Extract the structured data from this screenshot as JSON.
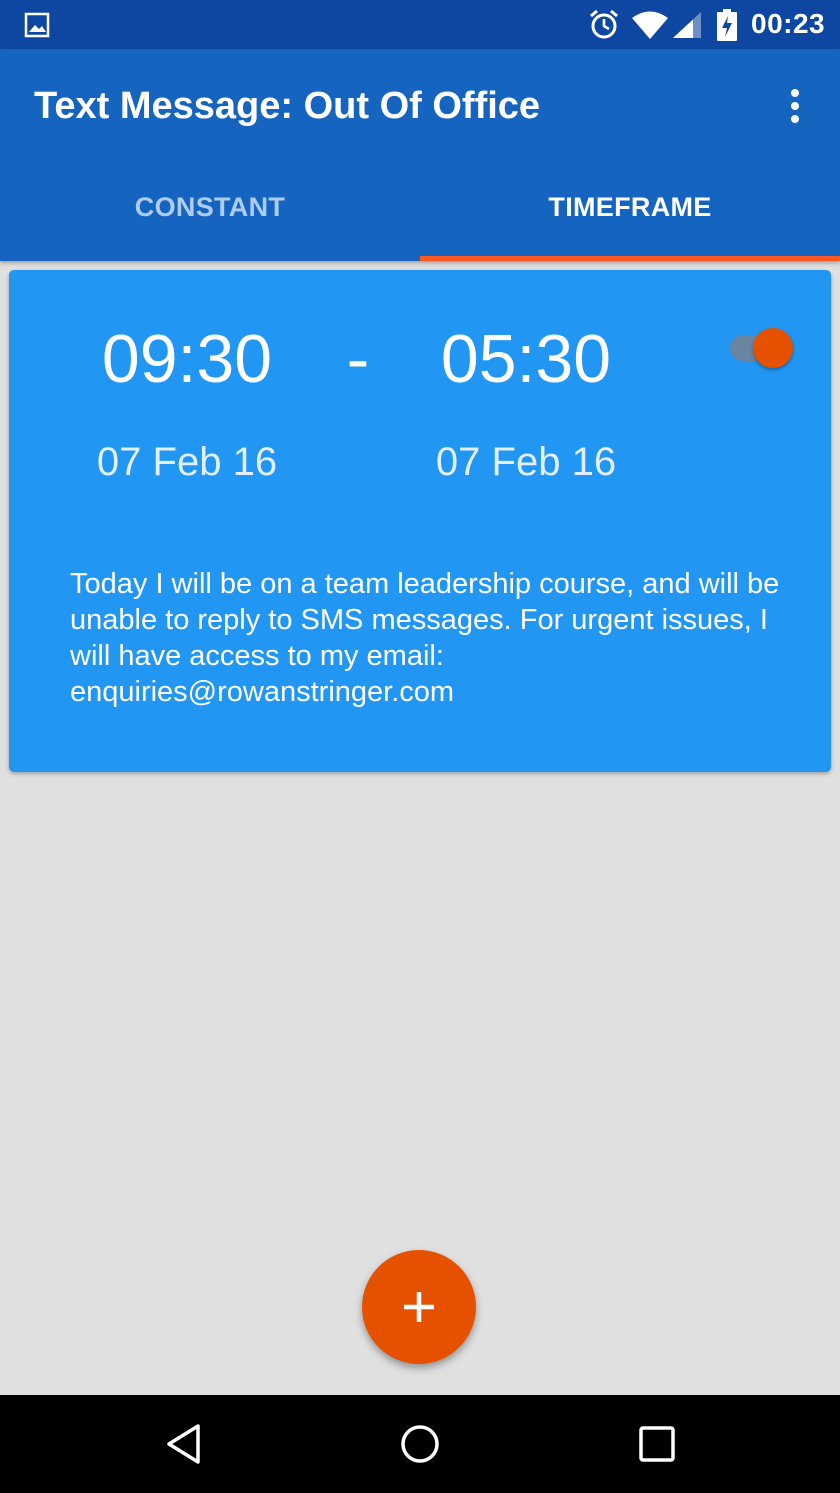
{
  "status_bar": {
    "time": "00:23",
    "icons": [
      "gallery-icon",
      "alarm-icon",
      "wifi-icon",
      "signal-icon",
      "battery-charging-icon"
    ]
  },
  "app_bar": {
    "title": "Text Message: Out Of Office",
    "menu_icon": "more-vert-icon"
  },
  "tabs": [
    {
      "label": "CONSTANT",
      "selected": false
    },
    {
      "label": "TIMEFRAME",
      "selected": true
    }
  ],
  "card": {
    "start_time": "09:30",
    "separator": "-",
    "end_time": "05:30",
    "start_date": "07 Feb 16",
    "end_date": "07 Feb 16",
    "enabled": true,
    "message": "Today I will be on a team leadership course, and will be unable to reply to SMS messages. For urgent issues, I will have access to my email: enquiries@rowanstringer.com"
  },
  "fab": {
    "icon": "add-icon"
  },
  "nav_bar": {
    "icons": [
      "back-icon",
      "home-icon",
      "recents-icon"
    ]
  },
  "colors": {
    "status_bar": "#0d47a1",
    "app_bar": "#1565c0",
    "card": "#2196f3",
    "accent": "#e65100",
    "tab_indicator": "#ff5722",
    "background": "#e0e0e0"
  }
}
